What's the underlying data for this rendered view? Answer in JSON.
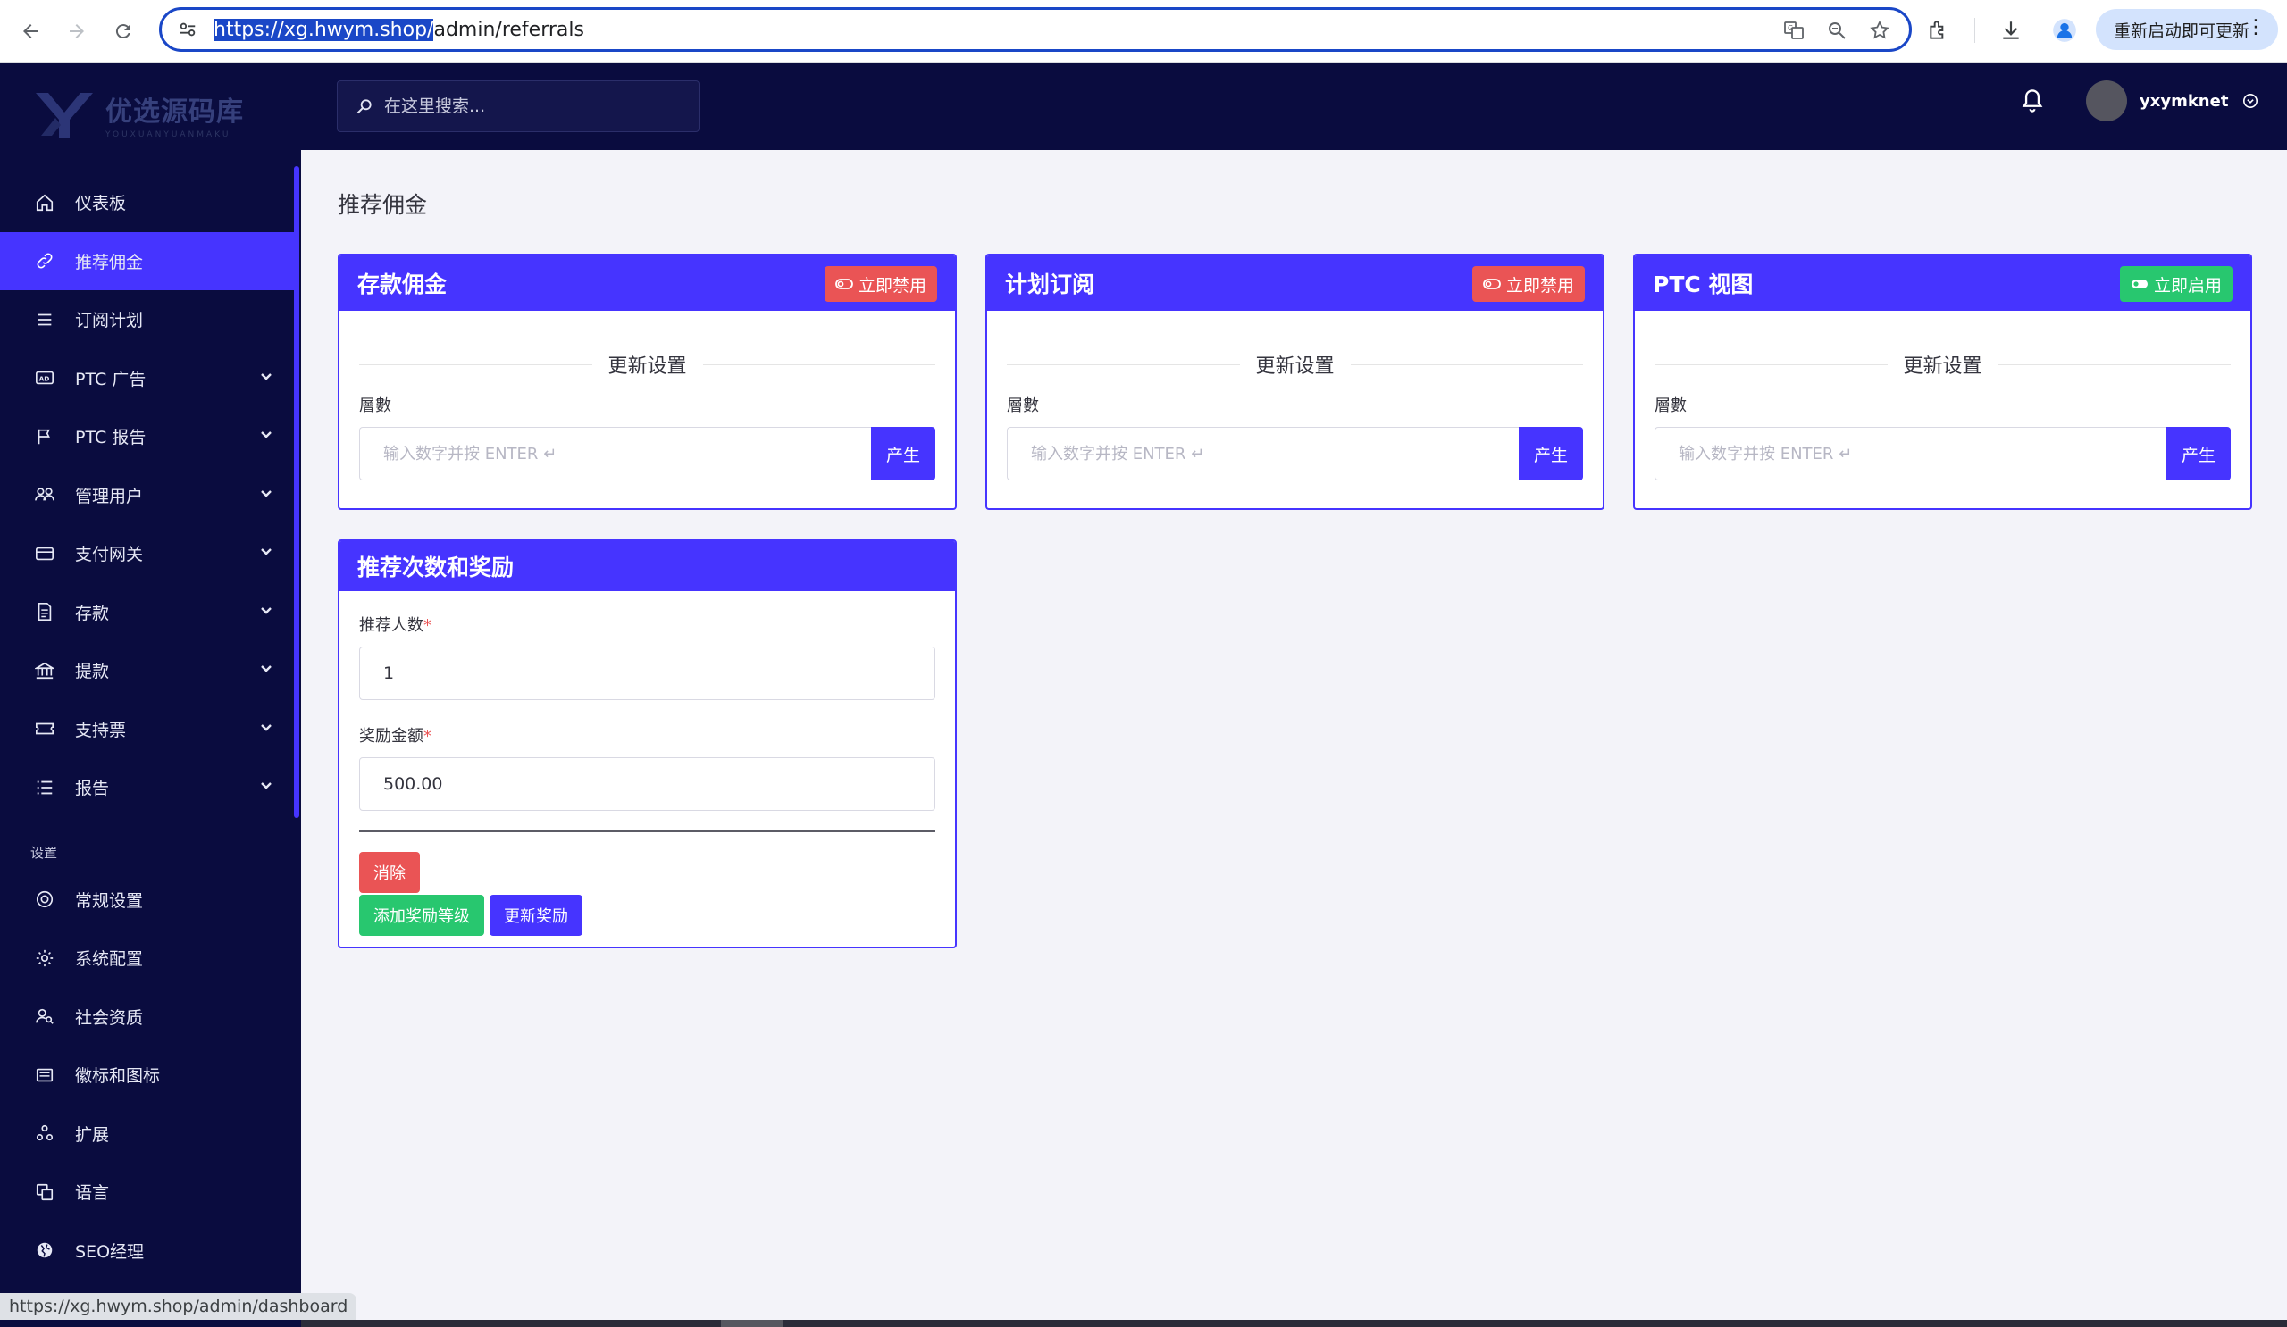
{
  "browser": {
    "url_selected": "https://xg.hwym.shop/",
    "url_rest": "admin/referrals",
    "restart_label": "重新启动即可更新"
  },
  "sidebar": {
    "logo_cn": "优选源码库",
    "logo_en": "YOUXUANYUANMAKU",
    "items": [
      {
        "label": "仪表板",
        "icon": "home-icon",
        "active": false,
        "expandable": false
      },
      {
        "label": "推荐佣金",
        "icon": "link-icon",
        "active": true,
        "expandable": false
      },
      {
        "label": "订阅计划",
        "icon": "list-icon",
        "active": false,
        "expandable": false
      },
      {
        "label": "PTC 广告",
        "icon": "ad-icon",
        "active": false,
        "expandable": true
      },
      {
        "label": "PTC 报告",
        "icon": "flag-icon",
        "active": false,
        "expandable": true
      },
      {
        "label": "管理用户",
        "icon": "users-icon",
        "active": false,
        "expandable": true
      },
      {
        "label": "支付网关",
        "icon": "credit-card-icon",
        "active": false,
        "expandable": true
      },
      {
        "label": "存款",
        "icon": "deposit-icon",
        "active": false,
        "expandable": true
      },
      {
        "label": "提款",
        "icon": "bank-icon",
        "active": false,
        "expandable": true
      },
      {
        "label": "支持票",
        "icon": "ticket-icon",
        "active": false,
        "expandable": true
      },
      {
        "label": "报告",
        "icon": "report-icon",
        "active": false,
        "expandable": true
      }
    ],
    "section_label": "设置",
    "settings_items": [
      {
        "label": "常规设置",
        "icon": "life-ring-icon"
      },
      {
        "label": "系统配置",
        "icon": "cog-icon"
      },
      {
        "label": "社会资质",
        "icon": "user-search-icon"
      },
      {
        "label": "徽标和图标",
        "icon": "images-icon"
      },
      {
        "label": "扩展",
        "icon": "puzzle-icon"
      },
      {
        "label": "语言",
        "icon": "language-icon"
      },
      {
        "label": "SEO经理",
        "icon": "globe-icon"
      }
    ]
  },
  "topbar": {
    "search_placeholder": "在这里搜索...",
    "username": "yxymknet"
  },
  "page": {
    "title": "推荐佣金"
  },
  "cards": [
    {
      "title": "存款佣金",
      "toggle_label": "立即禁用",
      "toggle_color": "#ea5455",
      "section_title": "更新设置",
      "field_label": "層數",
      "placeholder": "输入数字并按 ENTER ↵",
      "generate_label": "产生"
    },
    {
      "title": "计划订阅",
      "toggle_label": "立即禁用",
      "toggle_color": "#ea5455",
      "section_title": "更新设置",
      "field_label": "層數",
      "placeholder": "输入数字并按 ENTER ↵",
      "generate_label": "产生"
    },
    {
      "title": "PTC 视图",
      "toggle_label": "立即启用",
      "toggle_color": "#28c76f",
      "section_title": "更新设置",
      "field_label": "層數",
      "placeholder": "输入数字并按 ENTER ↵",
      "generate_label": "产生"
    }
  ],
  "reward_card": {
    "title": "推荐次数和奖励",
    "count_label": "推荐人数",
    "count_value": "1",
    "amount_label": "奖励金额",
    "amount_value": "500.00",
    "required_mark": "*",
    "delete_label": "消除",
    "add_level_label": "添加奖励等级",
    "update_label": "更新奖励"
  },
  "status_bar": {
    "hover_url": "https://xg.hwym.shop/admin/dashboard"
  },
  "colors": {
    "accent": "#4634ff",
    "sidebar_bg": "#0a0c3f",
    "danger": "#ea5455",
    "success": "#28c76f"
  }
}
